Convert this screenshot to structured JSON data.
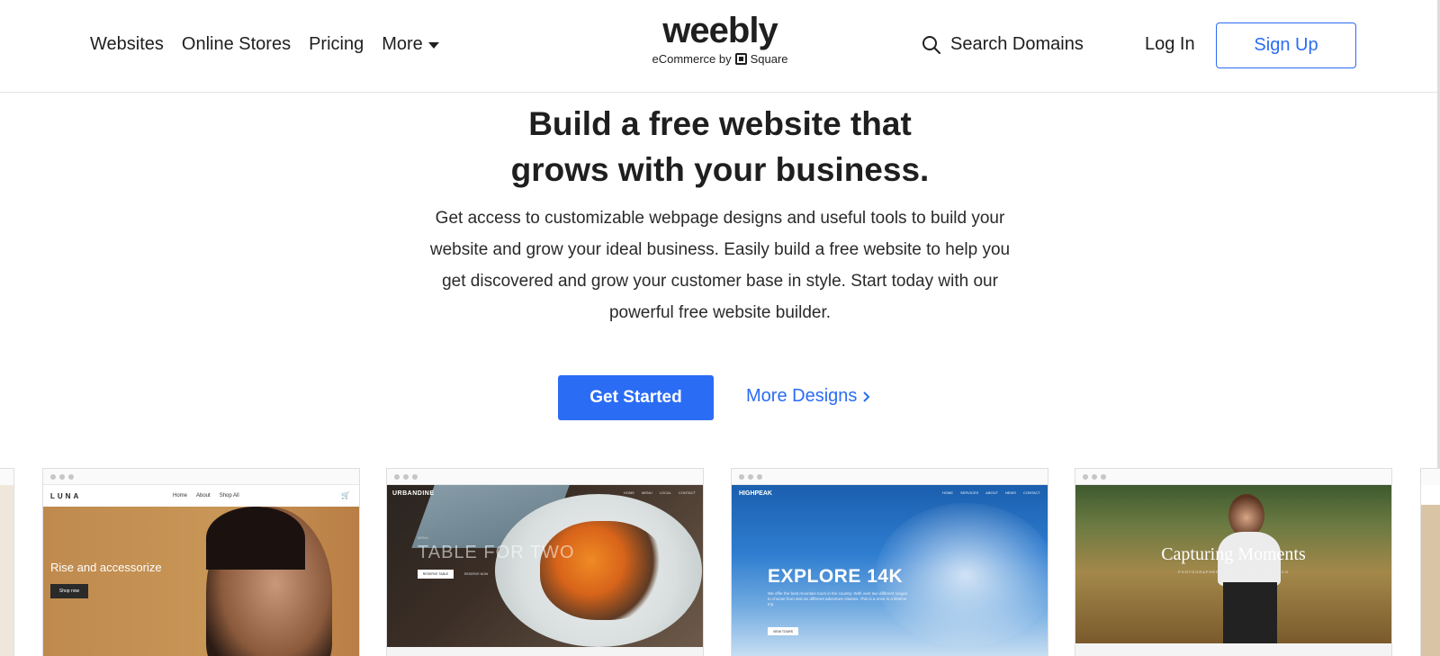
{
  "header": {
    "nav": [
      {
        "label": "Websites"
      },
      {
        "label": "Online Stores"
      },
      {
        "label": "Pricing"
      },
      {
        "label": "More"
      }
    ],
    "logo": {
      "word": "weebly",
      "sub_prefix": "eCommerce by",
      "sub_brand": "Square"
    },
    "search_domains": "Search Domains",
    "login": "Log In",
    "signup": "Sign Up"
  },
  "hero": {
    "title_line1": "Build a free website that",
    "title_line2": "grows with your business.",
    "description": "Get access to customizable webpage designs and useful tools to build your website and grow your ideal business. Easily build a free website to help you get discovered and grow your customer base in style. Start today with our powerful free website builder.",
    "cta_primary": "Get Started",
    "cta_secondary": "More Designs"
  },
  "templates": {
    "luna": {
      "brand": "LUNA",
      "nav": [
        "Home",
        "About",
        "Shop All"
      ],
      "headline": "Rise and accessorize",
      "button": "Shop now"
    },
    "urbandine": {
      "brand": "URBANDINE",
      "nav": [
        "HOME",
        "MENU",
        "LOCAL",
        "CONTACT"
      ],
      "kicker": "MENU",
      "headline": "TABLE FOR TWO",
      "button1": "RESERVE TABLE",
      "button2": "RESERVE NOW"
    },
    "highpeak": {
      "brand": "HIGHPEAK",
      "nav": [
        "HOME",
        "SERVICES",
        "ABOUT",
        "NEWS",
        "CONTACT"
      ],
      "headline": "EXPLORE 14K",
      "description": "We offer the best mountain tours in the country. With over two different ranges to choose from and six different adventure classes. This is a once in a lifetime trip.",
      "button": "VIEW TOURS"
    },
    "capturing": {
      "headline": "Capturing Moments",
      "sub": "PHOTOGRAPHER BASED IN SAN FRANCISCO"
    }
  },
  "colors": {
    "accent": "#2b6cf5",
    "text": "#1f1f1f",
    "border": "#e3e3e3"
  }
}
